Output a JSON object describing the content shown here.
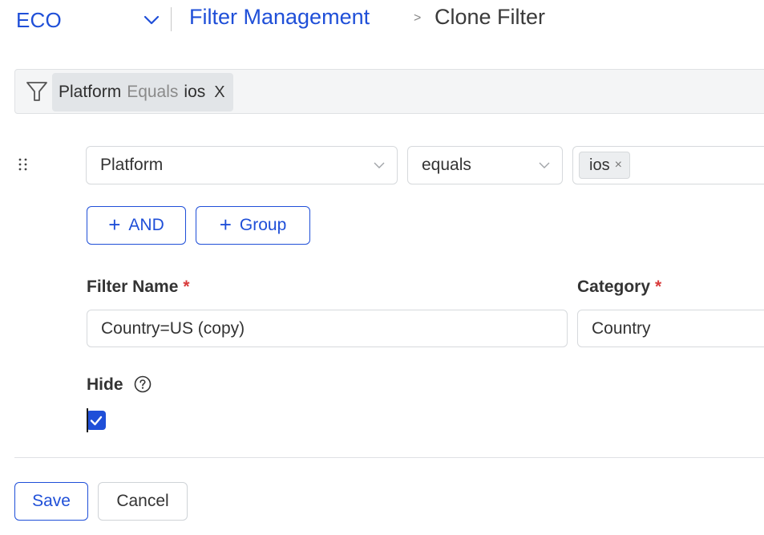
{
  "header": {
    "app_name": "ECO",
    "breadcrumb_link": "Filter Management",
    "breadcrumb_separator": ">",
    "page_title": "Clone Filter"
  },
  "summary": {
    "field": "Platform",
    "operator": "Equals",
    "value": "ios",
    "remove_glyph": "X"
  },
  "condition": {
    "field_value": "Platform",
    "operator_value": "equals",
    "tag_value": "ios",
    "tag_remove_glyph": "×"
  },
  "actions": {
    "plus_glyph": "+",
    "and_label": "AND",
    "group_label": "Group"
  },
  "form": {
    "filter_name_label": "Filter Name",
    "filter_name_value": "Country=US (copy)",
    "category_label": "Category",
    "category_value": "Country",
    "required_marker": "*",
    "hide_label": "Hide",
    "hide_checked": true
  },
  "footer": {
    "save_label": "Save",
    "cancel_label": "Cancel"
  },
  "colors": {
    "accent": "#1f4fd8",
    "required": "#d93b3b"
  },
  "icons": [
    "chevron-down-icon",
    "funnel-icon",
    "close-icon",
    "drag-handle-icon",
    "help-circle-icon",
    "checkmark-icon",
    "plus-icon"
  ]
}
